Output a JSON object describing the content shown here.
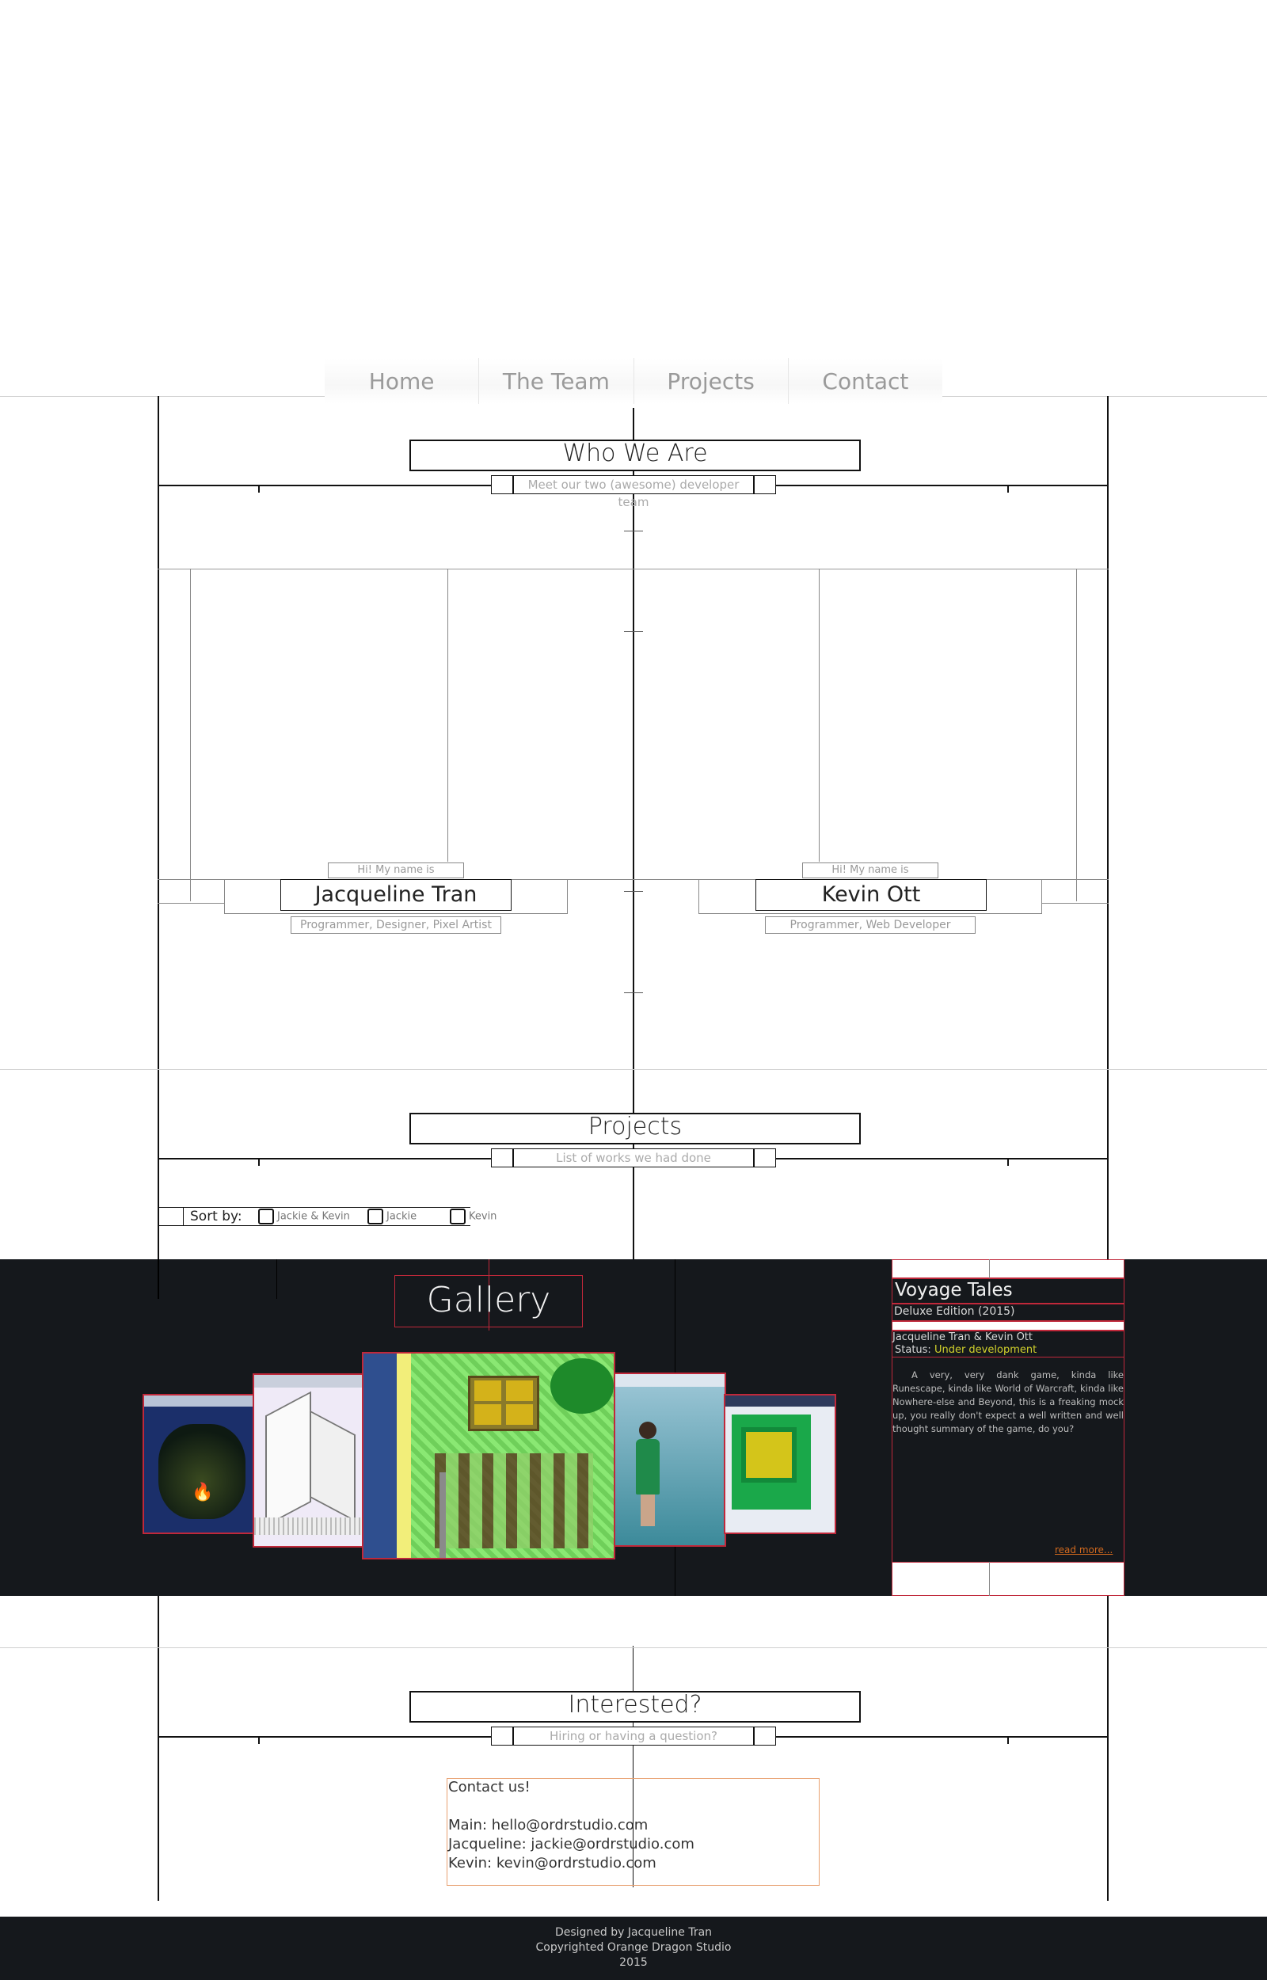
{
  "nav": {
    "items": [
      "Home",
      "The Team",
      "Projects",
      "Contact"
    ]
  },
  "team": {
    "title": "Who We Are",
    "subtitle": "Meet our two (awesome) developer team",
    "members": [
      {
        "greeting": "Hi! My name is",
        "name": "Jacqueline Tran",
        "role": "Programmer, Designer, Pixel Artist"
      },
      {
        "greeting": "Hi! My name is",
        "name": "Kevin Ott",
        "role": "Programmer, Web Developer"
      }
    ]
  },
  "projects": {
    "title": "Projects",
    "subtitle": "List of works we had done",
    "sort_label": "Sort by:",
    "sort_options": [
      "Jackie & Kevin",
      "Jackie",
      "Kevin"
    ]
  },
  "gallery": {
    "title": "Gallery",
    "project": {
      "name": "Voyage Tales",
      "edition": "Deluxe Edition (2015)",
      "authors": "Jacqueline Tran & Kevin Ott",
      "status_label": "Status:",
      "status_value": "Under development",
      "description": "A very, very dank game, kinda like Runescape, kinda like World of Warcraft, kinda like Nowhere-else and Beyond, this is a freaking mock up, you really don't expect a well written and well thought summary of the game, do you?",
      "read_more": "read more..."
    },
    "colors": {
      "background": "#15181c",
      "accent_red": "#c0283a",
      "status_yellow": "#d2d22c",
      "link_orange": "#d2691e"
    }
  },
  "contact": {
    "title": "Interested?",
    "subtitle": "Hiring or having a question?",
    "heading": "Contact us!",
    "lines": [
      "Main: hello@ordrstudio.com",
      "Jacqueline: jackie@ordrstudio.com",
      "Kevin: kevin@ordrstudio.com"
    ]
  },
  "footer": {
    "lines": [
      "Designed by Jacqueline Tran",
      "Copyrighted Orange Dragon Studio",
      "2015"
    ]
  }
}
